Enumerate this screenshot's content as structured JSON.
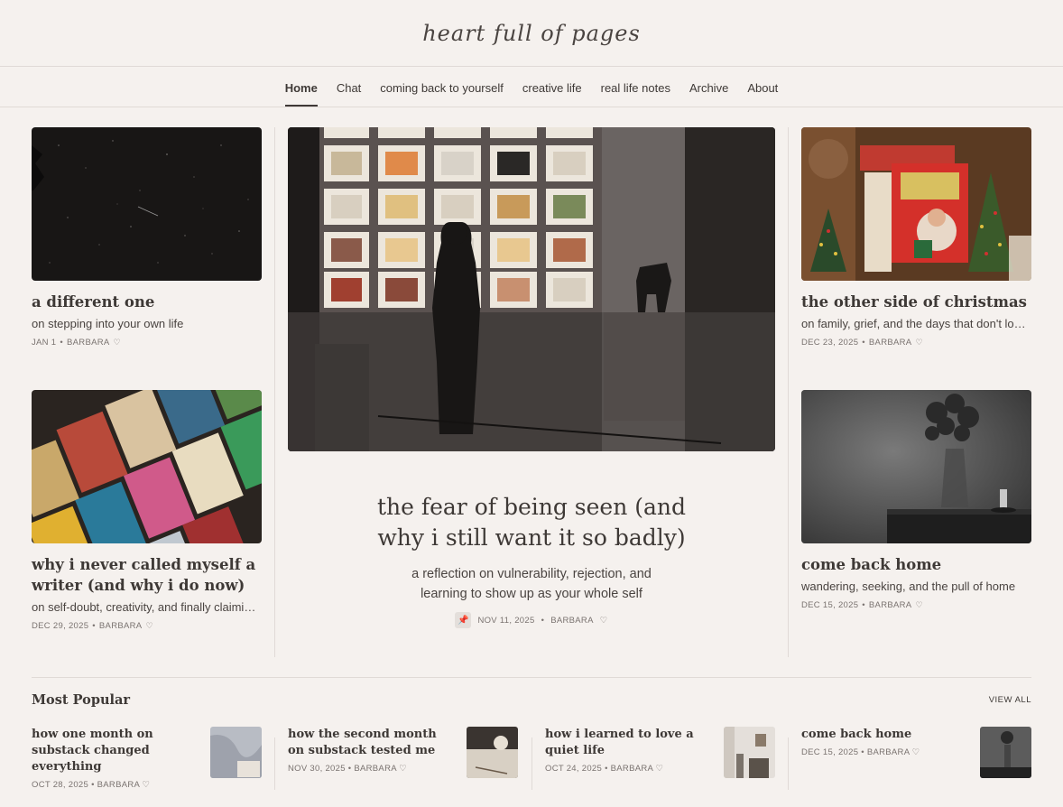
{
  "site": {
    "logo": "heart full of pages"
  },
  "nav": [
    {
      "label": "Home",
      "active": true
    },
    {
      "label": "Chat"
    },
    {
      "label": "coming back to yourself"
    },
    {
      "label": "creative life"
    },
    {
      "label": "real life notes"
    },
    {
      "label": "Archive"
    },
    {
      "label": "About"
    }
  ],
  "left": [
    {
      "title": "a different one",
      "subtitle": "on stepping into your own life",
      "date": "JAN 1",
      "author": "BARBARA",
      "image": "night-sky-photo"
    },
    {
      "title": "why i never called myself a writer (and why i do now)",
      "subtitle": "on self-doubt, creativity, and finally claiming…",
      "date": "DEC 29, 2025",
      "author": "BARBARA",
      "image": "books-table-photo"
    }
  ],
  "hero": {
    "title": "the fear of being seen (and why i still want it so badly)",
    "subtitle": "a reflection on vulnerability, rejection, and learning to show up as your whole self",
    "date": "NOV 11, 2025",
    "author": "BARBARA",
    "pin": "📌",
    "image": "gallery-silhouette-photo"
  },
  "right": [
    {
      "title": "the other side of christmas",
      "subtitle": "on family, grief, and the days that don't loo…",
      "date": "DEC 23, 2025",
      "author": "BARBARA",
      "image": "christmas-decor-photo"
    },
    {
      "title": "come back home",
      "subtitle": "wandering, seeking, and the pull of home",
      "date": "DEC 15, 2025",
      "author": "BARBARA",
      "image": "vase-flowers-photo"
    }
  ],
  "popular": {
    "heading": "Most Popular",
    "view_all": "VIEW ALL",
    "items": [
      {
        "title": "how one month on substack changed everything",
        "date": "OCT 28, 2025",
        "author": "BARBARA"
      },
      {
        "title": "how the second month on substack tested me",
        "date": "NOV 30, 2025",
        "author": "BARBARA"
      },
      {
        "title": "how i learned to love a quiet life",
        "date": "OCT 24, 2025",
        "author": "BARBARA"
      },
      {
        "title": "come back home",
        "date": "DEC 15, 2025",
        "author": "BARBARA"
      }
    ]
  },
  "separator": "•",
  "heart": "♡",
  "colors": {
    "background": "#f5f1ee",
    "text": "#3e3936",
    "muted": "#7a7370",
    "divider": "#e0dad6"
  }
}
